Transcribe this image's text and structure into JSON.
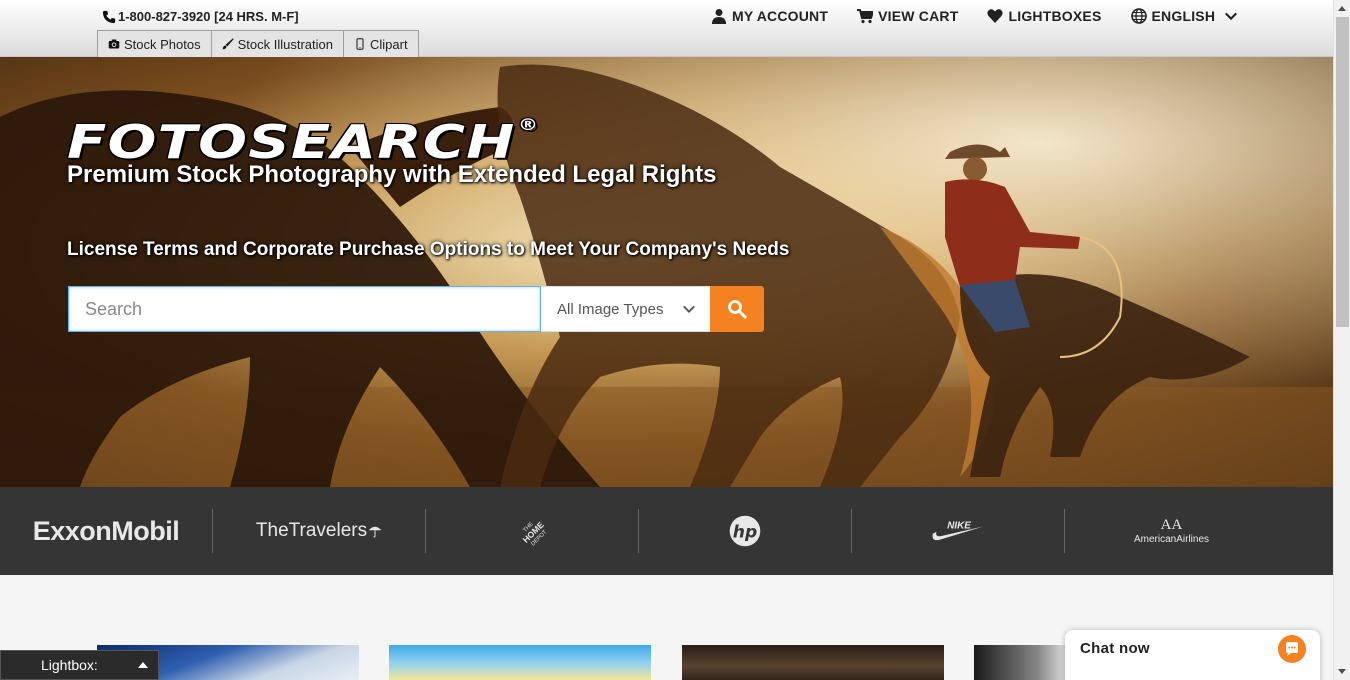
{
  "header": {
    "phone": "1-800-827-3920 [24 HRS. M-F]",
    "links": [
      {
        "label": "MY ACCOUNT",
        "icon": "user-icon"
      },
      {
        "label": "VIEW CART",
        "icon": "cart-icon"
      },
      {
        "label": "LIGHTBOXES",
        "icon": "heart-icon"
      },
      {
        "label": "ENGLISH",
        "icon": "globe-icon"
      }
    ],
    "tabs": [
      {
        "label": "Stock Photos",
        "icon": "camera-icon"
      },
      {
        "label": "Stock Illustration",
        "icon": "brush-icon"
      },
      {
        "label": "Clipart",
        "icon": "mobile-icon"
      }
    ]
  },
  "hero": {
    "logo": "FOTOSEARCH",
    "logo_mark": "®",
    "tagline": "Premium Stock Photography with Extended Legal Rights",
    "subline": "License Terms and Corporate Purchase Options to Meet Your Company's Needs",
    "search": {
      "placeholder": "Search",
      "value": "",
      "type_select": "All Image Types"
    }
  },
  "clients": {
    "exxon": "ExxonMobil",
    "travelers": "TheTravelers",
    "homedepot": "THE HOME DEPOT",
    "hp": "hp",
    "nike": "NIKE",
    "aa_mark": "AA",
    "aa_name": "AmericanAirlines"
  },
  "lightbox": {
    "label": "Lightbox:"
  },
  "chat": {
    "label": "Chat now"
  },
  "colors": {
    "accent": "#f58220",
    "strip": "#353535"
  }
}
